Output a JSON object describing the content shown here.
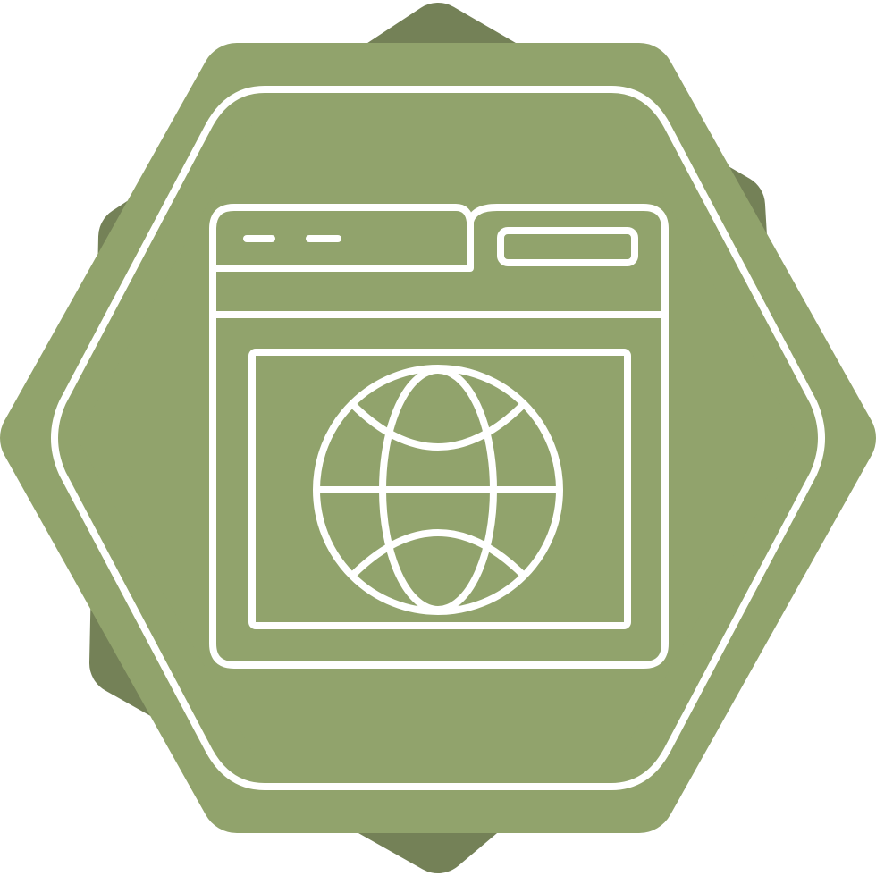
{
  "icon": {
    "name": "web-browser-globe-icon",
    "colors": {
      "background": "#ffffff",
      "back_shape": "#748157",
      "front_shape": "#91a36c",
      "line": "#ffffff"
    }
  }
}
